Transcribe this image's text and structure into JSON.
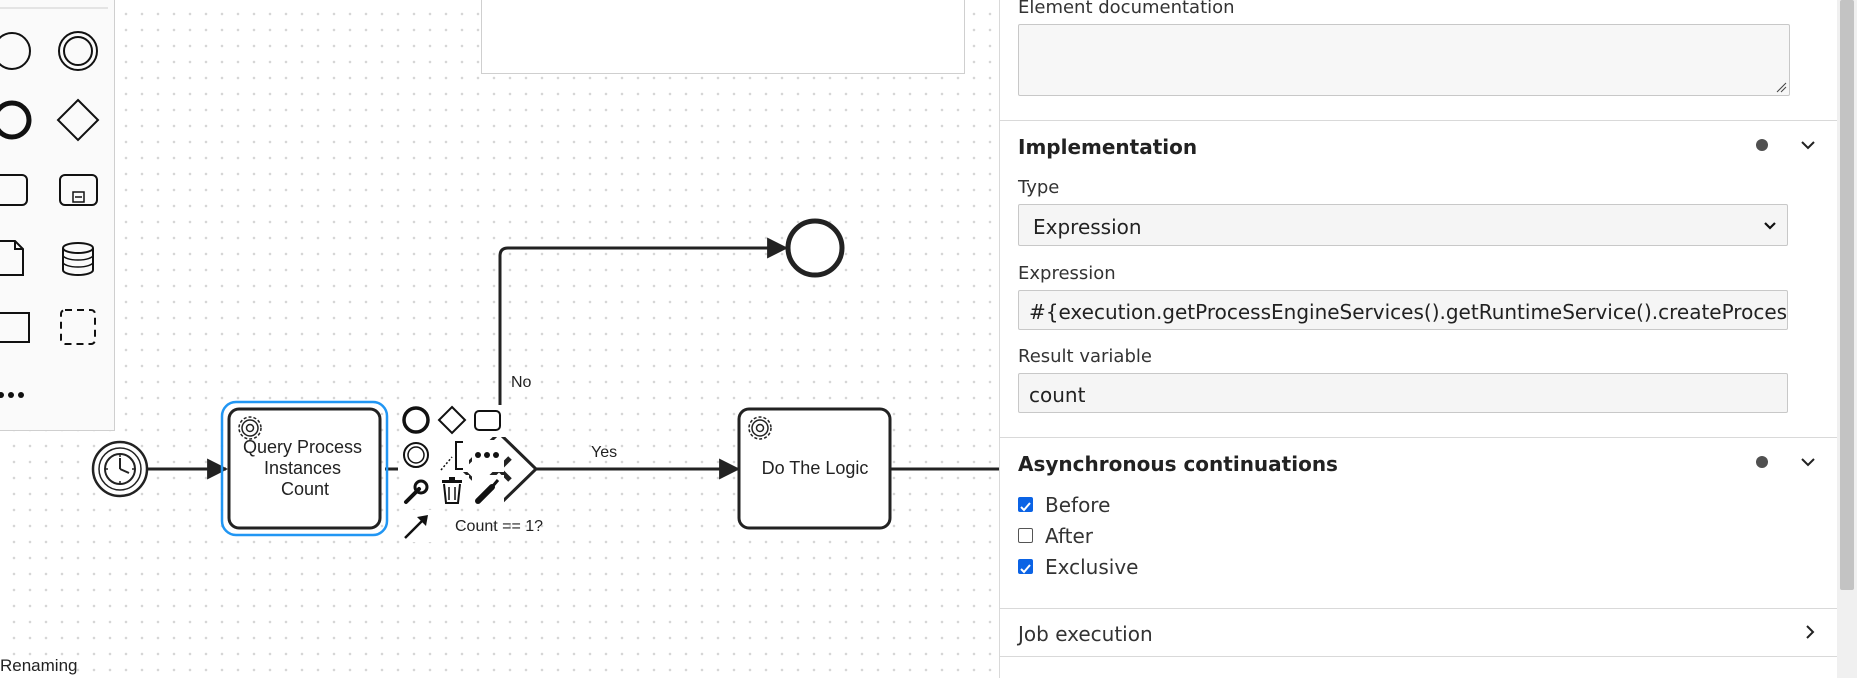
{
  "canvas": {
    "status_text": "Renaming",
    "tasks": {
      "query_label": [
        "Query Process",
        "Instances",
        "Count"
      ],
      "logic_label": "Do The Logic"
    },
    "flows": {
      "no_label": "No",
      "yes_label": "Yes",
      "gateway_label": "Count == 1?"
    }
  },
  "properties_panel": {
    "documentation": {
      "label": "Element documentation",
      "value": ""
    },
    "implementation": {
      "title": "Implementation",
      "type_label": "Type",
      "type_value": "Expression",
      "expression_label": "Expression",
      "expression_value": "#{execution.getProcessEngineServices().getRuntimeService().createProcessIns",
      "result_variable_label": "Result variable",
      "result_variable_value": "count"
    },
    "async": {
      "title": "Asynchronous continuations",
      "before_label": "Before",
      "before_checked": true,
      "after_label": "After",
      "after_checked": false,
      "exclusive_label": "Exclusive",
      "exclusive_checked": true
    },
    "job_execution": {
      "title": "Job execution"
    }
  },
  "colors": {
    "selection": "#2196f3",
    "checkbox_accent": "#0b63e5",
    "stroke": "#222222"
  }
}
